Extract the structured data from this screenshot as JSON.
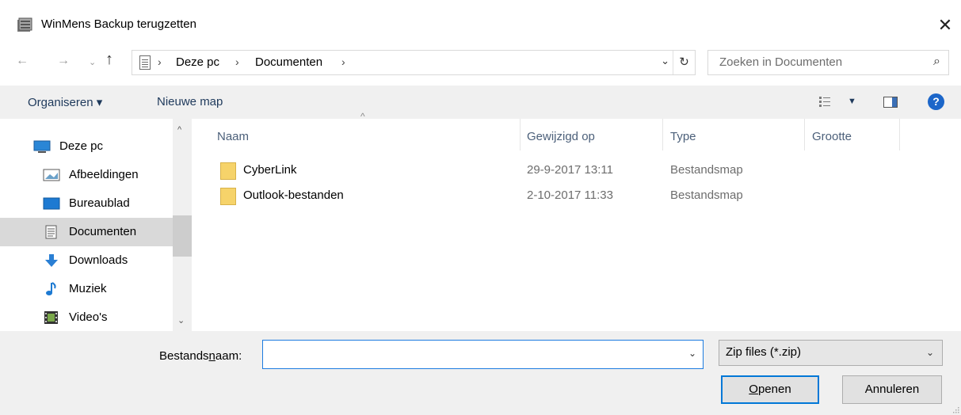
{
  "window": {
    "title": "WinMens Backup terugzetten",
    "close_glyph": "✕"
  },
  "navigation": {
    "back_glyph": "←",
    "forward_glyph": "→",
    "recent_glyph": "⌄",
    "up_glyph": "↑"
  },
  "address": {
    "breadcrumbs": [
      "Deze pc",
      "Documenten"
    ],
    "separator": "›",
    "dropdown_glyph": "⌄",
    "refresh_glyph": "↻"
  },
  "search": {
    "placeholder": "Zoeken in Documenten",
    "icon_glyph": "⌕"
  },
  "toolbar": {
    "organize_label": "Organiseren ▾",
    "new_folder_label": "Nieuwe map",
    "views_dd_glyph": "▼",
    "help_glyph": "?"
  },
  "sidebar": {
    "items": [
      {
        "label": "Deze pc",
        "icon": "computer-icon",
        "selected": false
      },
      {
        "label": "Afbeeldingen",
        "icon": "pictures-icon",
        "selected": false
      },
      {
        "label": "Bureaublad",
        "icon": "desktop-icon",
        "selected": false
      },
      {
        "label": "Documenten",
        "icon": "documents-icon",
        "selected": true
      },
      {
        "label": "Downloads",
        "icon": "downloads-icon",
        "selected": false
      },
      {
        "label": "Muziek",
        "icon": "music-icon",
        "selected": false
      },
      {
        "label": "Video's",
        "icon": "videos-icon",
        "selected": false
      }
    ],
    "scroll_up_glyph": "^",
    "scroll_down_glyph": "⌄"
  },
  "filelist": {
    "columns": [
      "Naam",
      "Gewijzigd op",
      "Type",
      "Grootte"
    ],
    "sort_glyph": "^",
    "rows": [
      {
        "name": "CyberLink",
        "modified": "29-9-2017 13:11",
        "type": "Bestandsmap",
        "size": ""
      },
      {
        "name": "Outlook-bestanden",
        "modified": "2-10-2017 11:33",
        "type": "Bestandsmap",
        "size": ""
      }
    ]
  },
  "bottom": {
    "filename_label_pre": "Bestands",
    "filename_label_ul": "n",
    "filename_label_post": "aam:",
    "filename_value": "",
    "filename_dd_glyph": "⌄",
    "filetype_value": "Zip files (*.zip)",
    "filetype_dd_glyph": "⌄",
    "open_label_ul": "O",
    "open_label_rest": "penen",
    "cancel_label": "Annuleren"
  }
}
